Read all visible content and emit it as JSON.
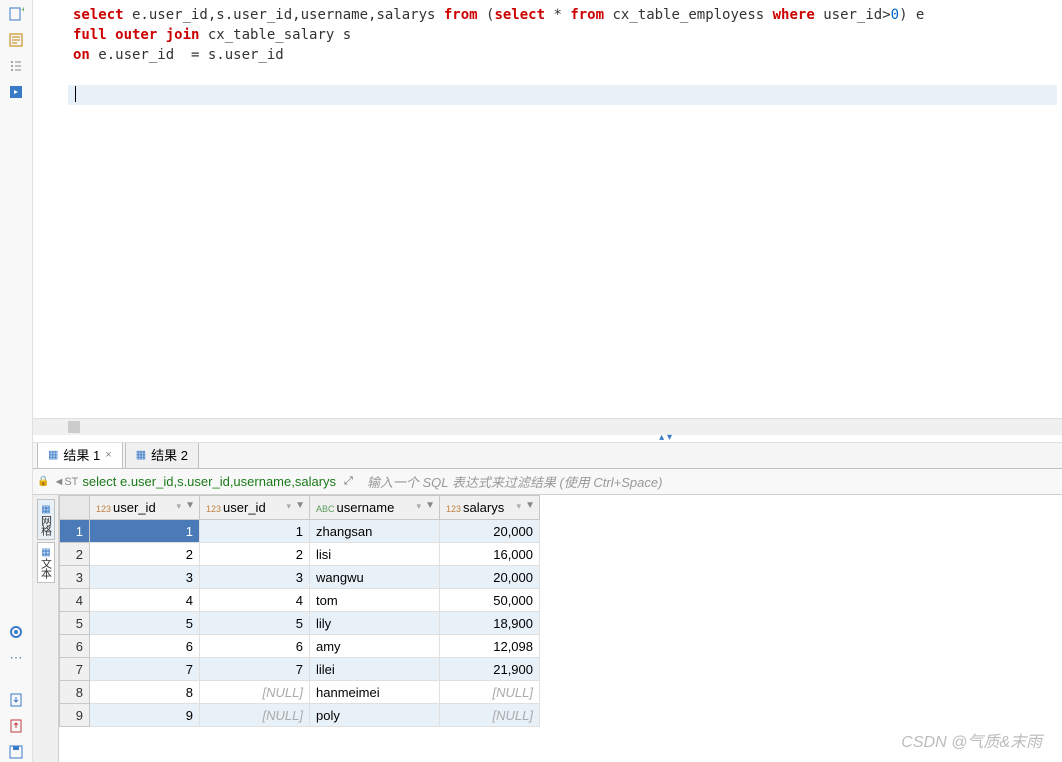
{
  "sql": {
    "line1_kw_select": "select",
    "line1_a": " e.user_id,s.user_id,username,salarys ",
    "line1_kw_from": "from",
    "line1_b": " (",
    "line1_kw_select2": "select",
    "line1_c": " * ",
    "line1_kw_from2": "from",
    "line1_d": " cx_table_employess ",
    "line1_kw_where": "where",
    "line1_e": " user_id>",
    "line1_num": "0",
    "line1_f": ") e",
    "line2_kw_full": "full",
    "line2_kw_outer": " outer",
    "line2_kw_join": " join",
    "line2_a": " cx_table_salary s",
    "line3_kw_on": "on",
    "line3_a": " e.user_id  = s.user_id"
  },
  "tabs": {
    "tab1": "结果 1",
    "tab2": "结果 2"
  },
  "query_bar": {
    "sql": "select e.user_id,s.user_id,username,salarys",
    "filter_placeholder": "输入一个 SQL 表达式来过滤结果 (使用 Ctrl+Space)"
  },
  "side_tabs": {
    "t1": "网格",
    "t2": "文本"
  },
  "columns": {
    "c1": "user_id",
    "c2": "user_id",
    "c3": "username",
    "c4": "salarys"
  },
  "rows": [
    {
      "n": "1",
      "u1": "1",
      "u2": "1",
      "name": "zhangsan",
      "sal": "20,000"
    },
    {
      "n": "2",
      "u1": "2",
      "u2": "2",
      "name": "lisi",
      "sal": "16,000"
    },
    {
      "n": "3",
      "u1": "3",
      "u2": "3",
      "name": "wangwu",
      "sal": "20,000"
    },
    {
      "n": "4",
      "u1": "4",
      "u2": "4",
      "name": "tom",
      "sal": "50,000"
    },
    {
      "n": "5",
      "u1": "5",
      "u2": "5",
      "name": "lily",
      "sal": "18,900"
    },
    {
      "n": "6",
      "u1": "6",
      "u2": "6",
      "name": "amy",
      "sal": "12,098"
    },
    {
      "n": "7",
      "u1": "7",
      "u2": "7",
      "name": "lilei",
      "sal": "21,900"
    },
    {
      "n": "8",
      "u1": "8",
      "u2": "[NULL]",
      "name": "hanmeimei",
      "sal": "[NULL]"
    },
    {
      "n": "9",
      "u1": "9",
      "u2": "[NULL]",
      "name": "poly",
      "sal": "[NULL]"
    }
  ],
  "watermark": "CSDN @气质&末雨"
}
